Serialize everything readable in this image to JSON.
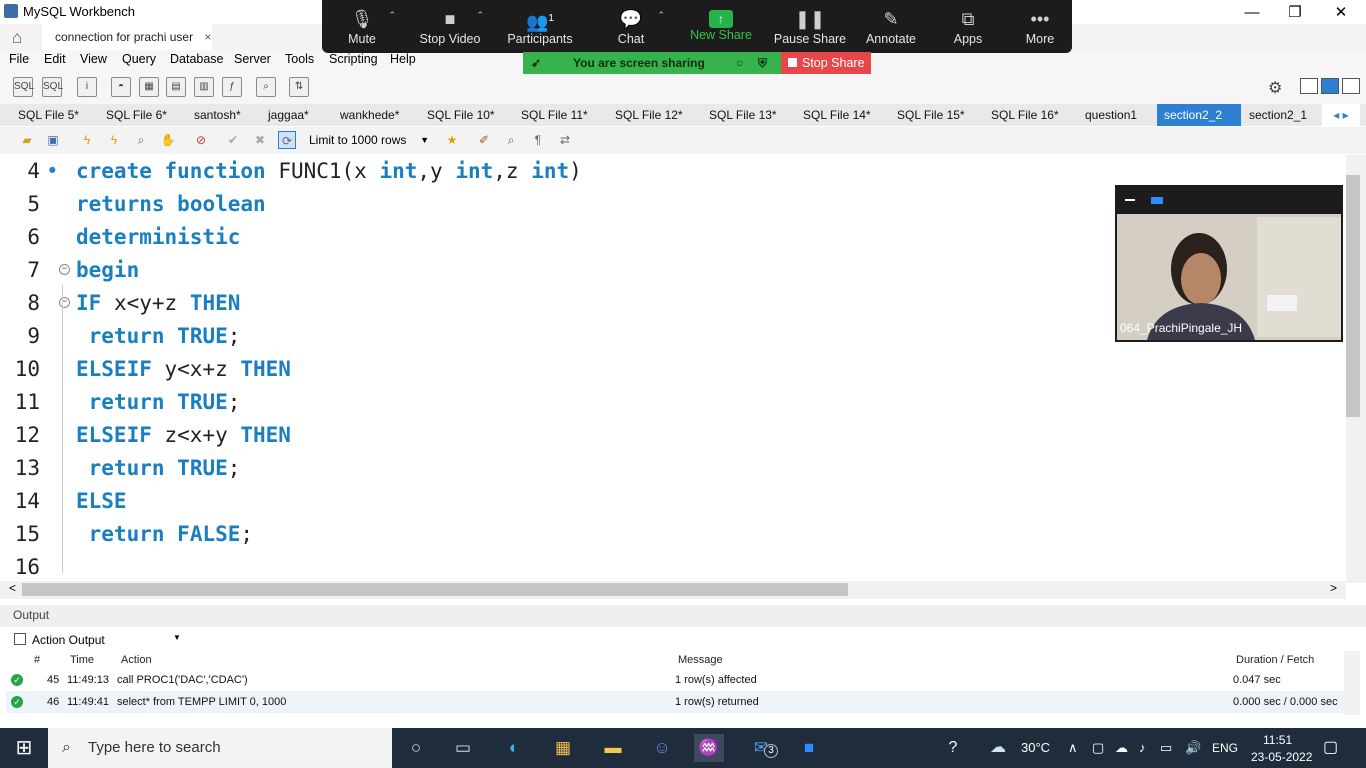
{
  "window": {
    "title": "MySQL Workbench",
    "minimize": "—",
    "maximize": "❐",
    "close": "✕"
  },
  "zoom": {
    "buttons": [
      {
        "label": "Mute"
      },
      {
        "label": "Stop Video"
      },
      {
        "label": "Participants",
        "count": "1"
      },
      {
        "label": "Chat"
      },
      {
        "label": "New Share"
      },
      {
        "label": "Pause Share"
      },
      {
        "label": "Annotate"
      },
      {
        "label": "Apps"
      },
      {
        "label": "More"
      }
    ],
    "banner": "You are screen sharing",
    "stop_share": "Stop Share"
  },
  "connection_tab": {
    "label": "connection for prachi user",
    "close": "×"
  },
  "menu": [
    "File",
    "Edit",
    "View",
    "Query",
    "Database",
    "Server",
    "Tools",
    "Scripting",
    "Help"
  ],
  "sql_tabs": [
    "SQL File 5*",
    "SQL File 6*",
    "santosh*",
    "jaggaa*",
    "wankhede*",
    "SQL File 10*",
    "SQL File 11*",
    "SQL File 12*",
    "SQL File 13*",
    "SQL File 14*",
    "SQL File 15*",
    "SQL File 16*",
    "question1",
    "section2_2",
    "section2_1"
  ],
  "active_tab": "section2_2",
  "limit_rows": "Limit to 1000 rows",
  "editor": {
    "lines": [
      {
        "num": "4",
        "text": "create function FUNC1(x int,y int,z int)"
      },
      {
        "num": "5",
        "text": "returns boolean"
      },
      {
        "num": "6",
        "text": "deterministic"
      },
      {
        "num": "7",
        "text": "begin"
      },
      {
        "num": "8",
        "text": "IF x<y+z THEN"
      },
      {
        "num": "9",
        "text": " return TRUE;"
      },
      {
        "num": "10",
        "text": "ELSEIF y<x+z THEN"
      },
      {
        "num": "11",
        "text": " return TRUE;"
      },
      {
        "num": "12",
        "text": "ELSEIF z<x+y THEN"
      },
      {
        "num": "13",
        "text": " return TRUE;"
      },
      {
        "num": "14",
        "text": "ELSE"
      },
      {
        "num": "15",
        "text": " return FALSE;"
      },
      {
        "num": "16",
        "text": ""
      }
    ]
  },
  "video": {
    "name": "064_PrachiPingale_JH"
  },
  "output": {
    "title": "Output",
    "selector": "Action Output",
    "columns": [
      "#",
      "Time",
      "Action",
      "Message",
      "Duration / Fetch"
    ],
    "rows": [
      {
        "num": "45",
        "time": "11:49:13",
        "action": "call PROC1('DAC','CDAC')",
        "message": "1 row(s) affected",
        "duration": "0.047 sec"
      },
      {
        "num": "46",
        "time": "11:49:41",
        "action": "select* from TEMPP LIMIT 0, 1000",
        "message": "1 row(s) returned",
        "duration": "0.000 sec / 0.000 sec"
      }
    ]
  },
  "taskbar": {
    "search_placeholder": "Type here to search",
    "weather": "30°C",
    "lang": "ENG",
    "time": "11:51",
    "date": "23-05-2022",
    "mail_badge": "3"
  },
  "colors": {
    "accent": "#2c7fd1",
    "keyword": "#1a7fc1",
    "share_green": "#36b34b",
    "stop_red": "#e8474a"
  }
}
